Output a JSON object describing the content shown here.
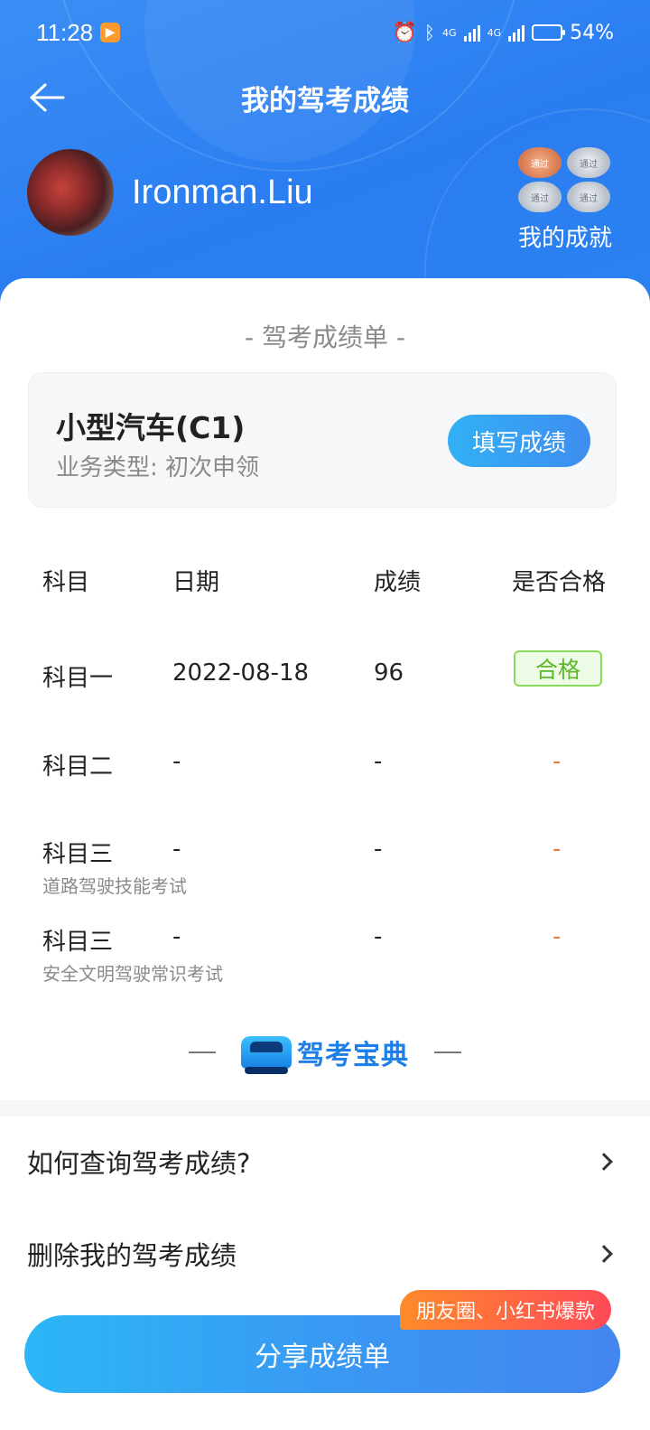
{
  "status_bar": {
    "time": "11:28",
    "network1": "4G",
    "network2": "4G",
    "battery": "54%",
    "battery_level": 0.54
  },
  "nav": {
    "title": "我的驾考成绩"
  },
  "profile": {
    "username": "Ironman.Liu",
    "achievements_label": "我的成就",
    "medal_text": "通过"
  },
  "sheet": {
    "title": "- 驾考成绩单 -",
    "license_name": "小型汽车(C1)",
    "business_type": "业务类型:  初次申领",
    "fill_button": "填写成绩"
  },
  "table": {
    "headers": [
      "科目",
      "日期",
      "成绩",
      "是否合格"
    ],
    "rows": [
      {
        "subject": "科目一",
        "sub": "",
        "date": "2022-08-18",
        "score": "96",
        "result": "合格"
      },
      {
        "subject": "科目二",
        "sub": "",
        "date": "-",
        "score": "-",
        "result": "-"
      },
      {
        "subject": "科目三",
        "sub": "道路驾驶技能考试",
        "date": "-",
        "score": "-",
        "result": "-"
      },
      {
        "subject": "科目三",
        "sub": "安全文明驾驶常识考试",
        "date": "-",
        "score": "-",
        "result": "-"
      }
    ]
  },
  "brand": {
    "name": "驾考宝典"
  },
  "menu": {
    "items": [
      {
        "label": "如何查询驾考成绩?"
      },
      {
        "label": "删除我的驾考成绩"
      }
    ]
  },
  "bottom": {
    "share_button": "分享成绩单",
    "promo_badge": "朋友圈、小红书爆款"
  },
  "colors": {
    "header_blue": "#2a7df0",
    "pass_green": "#5cb82a",
    "dash_orange": "#f07a3a",
    "promo_red": "#ff4a58"
  }
}
